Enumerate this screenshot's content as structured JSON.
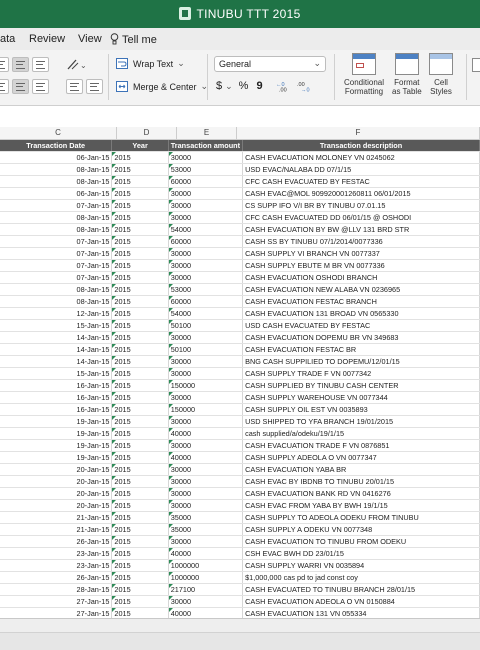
{
  "window": {
    "title": "TINUBU TTT 2015"
  },
  "menu": {
    "items": [
      "ata",
      "Review",
      "View"
    ],
    "tell_me": "Tell me"
  },
  "ribbon": {
    "wrap_text": "Wrap Text",
    "merge_center": "Merge & Center",
    "number_format": "General",
    "currency_symbol": "$",
    "percent_symbol": "%",
    "comma_symbol": "9",
    "conditional_formatting": [
      "Conditional",
      "Formatting"
    ],
    "format_as_table": [
      "Format",
      "as Table"
    ],
    "cell_styles": [
      "Cell",
      "Styles"
    ]
  },
  "columns": [
    "C",
    "D",
    "E",
    "F"
  ],
  "headers": [
    "Transaction Date",
    "Year",
    "Transaction amount",
    "Transaction description"
  ],
  "rows": [
    [
      "06-Jan-15",
      "2015",
      "30000",
      "CASH EVACUATION MOLONEY VN 0245062"
    ],
    [
      "08-Jan-15",
      "2015",
      "53000",
      "USD EVAC/NALABA DD 07/1/15"
    ],
    [
      "08-Jan-15",
      "2015",
      "60000",
      "CFC CASH EVACUATED BY FESTAC"
    ],
    [
      "06-Jan-15",
      "2015",
      "30000",
      "CASH EVAC@MOL 909920001260811 06/01/2015"
    ],
    [
      "07-Jan-15",
      "2015",
      "30000",
      "CS SUPP IFO V/I BR BY TINUBU 07.01.15"
    ],
    [
      "08-Jan-15",
      "2015",
      "30000",
      "CFC CASH EVACUATED DD 06/01/15 @ OSHODI"
    ],
    [
      "08-Jan-15",
      "2015",
      "54000",
      "CASH EVACUATION BY BW @LLV 131 BRD STR"
    ],
    [
      "07-Jan-15",
      "2015",
      "60000",
      "CASH SS BY TINUBU 07/1/2014/0077336"
    ],
    [
      "07-Jan-15",
      "2015",
      "30000",
      "CASH SUPPLY VI BRANCH VN 0077337"
    ],
    [
      "07-Jan-15",
      "2015",
      "30000",
      "CASH SUPPLY EBUTE M BR VN 0077336"
    ],
    [
      "07-Jan-15",
      "2015",
      "30000",
      "CASH EVACUATION OSHODI BRANCH"
    ],
    [
      "08-Jan-15",
      "2015",
      "53000",
      "CASH EVACUATION NEW ALABA VN 0236965"
    ],
    [
      "08-Jan-15",
      "2015",
      "60000",
      "CASH EVACUATION FESTAC BRANCH"
    ],
    [
      "12-Jan-15",
      "2015",
      "54000",
      "CASH EVACUATION 131 BROAD VN 0565330"
    ],
    [
      "15-Jan-15",
      "2015",
      "50100",
      "USD CASH EVACUATED BY FESTAC"
    ],
    [
      "14-Jan-15",
      "2015",
      "30000",
      "CASH EVACUATION DOPEMU BR VN 349683"
    ],
    [
      "14-Jan-15",
      "2015",
      "50100",
      "CASH EVACUATION FESTAC BR"
    ],
    [
      "14-Jan-15",
      "2015",
      "30000",
      "BNG CASH SUPPILIED TO DOPEMU/12/01/15"
    ],
    [
      "15-Jan-15",
      "2015",
      "30000",
      "CASH SUPPLY TRADE F VN 0077342"
    ],
    [
      "16-Jan-15",
      "2015",
      "150000",
      "CASH SUPPLIED BY TINUBU CASH CENTER"
    ],
    [
      "16-Jan-15",
      "2015",
      "30000",
      "CASH SUPPLY WAREHOUSE VN 0077344"
    ],
    [
      "16-Jan-15",
      "2015",
      "150000",
      "CASH SUPPLY OIL EST VN 0035893"
    ],
    [
      "19-Jan-15",
      "2015",
      "30000",
      "USD SHIPPED TO YFA BRANCH 19/01/2015"
    ],
    [
      "19-Jan-15",
      "2015",
      "40000",
      "cash supplied/a/odeku/19/1/15"
    ],
    [
      "19-Jan-15",
      "2015",
      "30000",
      "CASH EVACUATION TRADE F VN 0876851"
    ],
    [
      "19-Jan-15",
      "2015",
      "40000",
      "CASH SUPPLY ADEOLA O VN 0077347"
    ],
    [
      "20-Jan-15",
      "2015",
      "30000",
      "CASH EVACUATION YABA BR"
    ],
    [
      "20-Jan-15",
      "2015",
      "30000",
      "CASH EVAC BY IBDNB TO TINUBU 20/01/15"
    ],
    [
      "20-Jan-15",
      "2015",
      "30000",
      "CASH EVACUATION BANK RD VN 0416276"
    ],
    [
      "20-Jan-15",
      "2015",
      "30000",
      "CASH EVAC FROM YABA BY BWH 19/1/15"
    ],
    [
      "21-Jan-15",
      "2015",
      "35000",
      "CASH SUPPLY TO ADEOLA ODEKU FROM TINUBU"
    ],
    [
      "21-Jan-15",
      "2015",
      "35000",
      "CASH SUPPLY A ODEKU VN 0077348"
    ],
    [
      "26-Jan-15",
      "2015",
      "30000",
      "CASH EVACUATION TO TINUBU FROM ODEKU"
    ],
    [
      "23-Jan-15",
      "2015",
      "40000",
      "CSH EVAC BWH DD 23/01/15"
    ],
    [
      "23-Jan-15",
      "2015",
      "1000000",
      "CASH SUPPLY WARRI VN 0035894"
    ],
    [
      "26-Jan-15",
      "2015",
      "1000000",
      "$1,000,000 cas pd to jad const coy"
    ],
    [
      "28-Jan-15",
      "2015",
      "217100",
      "CASH EVACUATED TO TINUBU BRANCH 28/01/15"
    ],
    [
      "27-Jan-15",
      "2015",
      "30000",
      "CASH EVACUATION ADEOLA O VN 0150884"
    ],
    [
      "27-Jan-15",
      "2015",
      "40000",
      "CASH EVACUATION 131 VN 055334"
    ],
    [
      "28-Jan-15",
      "2015",
      "30000",
      "CASH EVACUATED @PALMS 27/01/2015"
    ]
  ]
}
